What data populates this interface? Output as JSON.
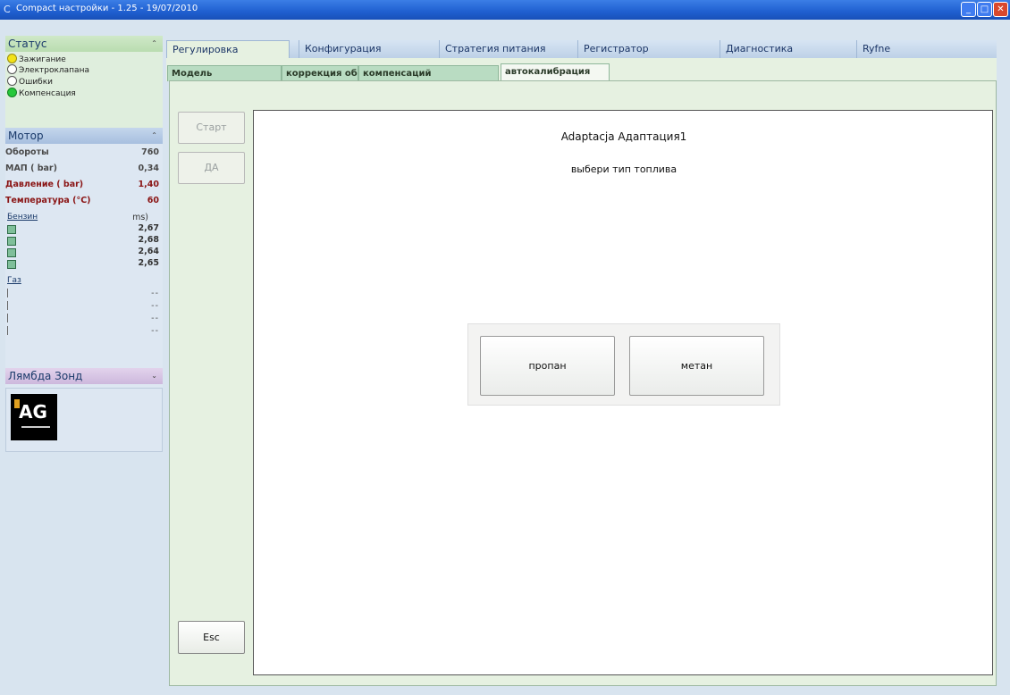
{
  "window": {
    "title": "Compact настройки - 1.25 - 19/07/2010"
  },
  "status": {
    "title": "Статус",
    "items": [
      {
        "label": "Зажигание",
        "state": "yellow"
      },
      {
        "label": "Электроклапана",
        "state": "off"
      },
      {
        "label": "Ошибки",
        "state": "off"
      },
      {
        "label": "Компенсация",
        "state": "green"
      }
    ]
  },
  "motor": {
    "title": "Мотор",
    "rows": [
      {
        "label": "Обороты",
        "value": "760"
      },
      {
        "label": "МАП ( bar)",
        "value": "0,34"
      },
      {
        "label": "Давление ( bar)",
        "value": "1,40"
      },
      {
        "label": "Температура (°C)",
        "value": "60"
      }
    ],
    "petrol_label": "Бензин",
    "petrol_unit": "ms)",
    "petrol_values": [
      "2,67",
      "2,68",
      "2,64",
      "2,65"
    ],
    "gas_label": "Газ",
    "gas_values": [
      "--",
      "--",
      "--",
      "--"
    ]
  },
  "lambda": {
    "title": "Лямбда Зонд",
    "logo_text": "AG"
  },
  "tabs": [
    "Регулировка",
    "Конфигурация",
    "Стратегия питания",
    "Регистратор",
    "Диагностика",
    "Ryfne"
  ],
  "subtabs": [
    "Модель",
    "коррекция оборотов",
    "компенсаций",
    "автокалибрация"
  ],
  "controls": {
    "start_label": "Старт",
    "da_label": "ДА",
    "esc_label": "Esc"
  },
  "panel": {
    "title": "Adaptacja Адаптация1",
    "subtitle": "выбери тип топлива",
    "propane_label": "пропан",
    "methane_label": "метан"
  }
}
